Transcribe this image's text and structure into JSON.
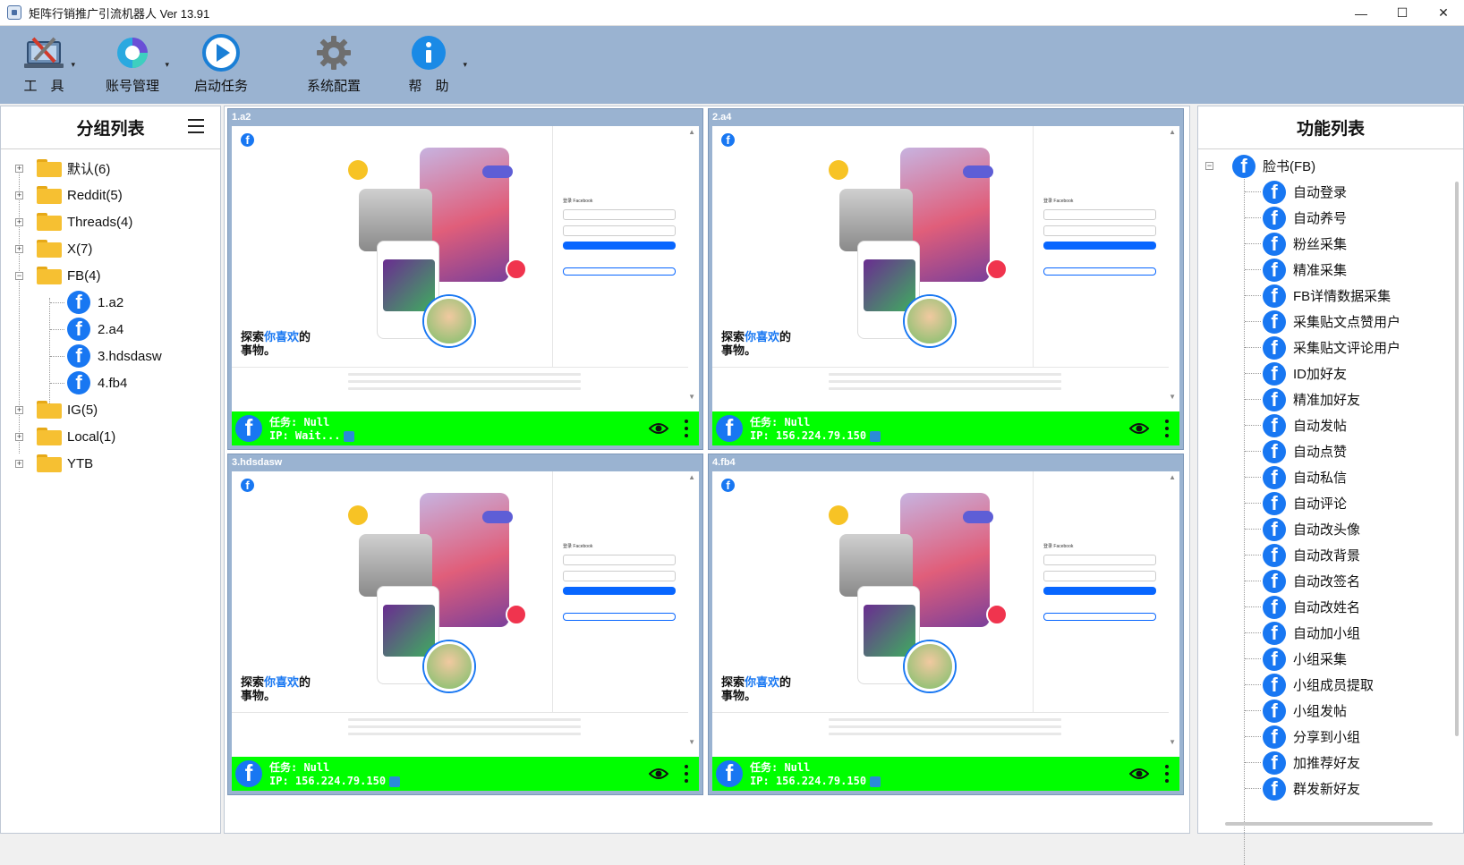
{
  "window": {
    "title": "矩阵行销推广引流机器人 Ver 13.91",
    "minimize": "—",
    "maximize": "☐",
    "close": "✕"
  },
  "toolbar": {
    "tools": "工　具",
    "accounts": "账号管理",
    "start_task": "启动任务",
    "settings": "系统配置",
    "help": "帮　助",
    "dropdown_glyph": "▾"
  },
  "left": {
    "title": "分组列表",
    "groups": [
      {
        "label": "默认(6)",
        "expanded": false
      },
      {
        "label": "Reddit(5)",
        "expanded": false
      },
      {
        "label": "Threads(4)",
        "expanded": false
      },
      {
        "label": "X(7)",
        "expanded": false
      },
      {
        "label": "FB(4)",
        "expanded": true
      },
      {
        "label": "IG(5)",
        "expanded": false
      },
      {
        "label": "Local(1)",
        "expanded": false
      },
      {
        "label": "YTB",
        "expanded": false
      }
    ],
    "fb_children": [
      "1.a2",
      "2.a4",
      "3.hdsdasw",
      "4.fb4"
    ]
  },
  "tiles": [
    {
      "name": "1.a2",
      "task": "任务: Null",
      "ip": "IP: Wait..."
    },
    {
      "name": "2.a4",
      "task": "任务: Null",
      "ip": "IP: 156.224.79.150"
    },
    {
      "name": "3.hdsdasw",
      "task": "任务: Null",
      "ip": "IP: 156.224.79.150"
    },
    {
      "name": "4.fb4",
      "task": "任务: Null",
      "ip": "IP: 156.224.79.150"
    }
  ],
  "fb_page": {
    "explore_a": "探索",
    "explore_hl": "你喜欢",
    "explore_b": "的",
    "explore_c": "事物。",
    "fb_letter": "f",
    "login_caption": "登录 Facebook"
  },
  "right": {
    "title": "功能列表",
    "root": "脸书(FB)",
    "items": [
      "自动登录",
      "自动养号",
      "粉丝采集",
      "精准采集",
      "FB详情数据采集",
      "采集贴文点赞用户",
      "采集贴文评论用户",
      "ID加好友",
      "精准加好友",
      "自动发帖",
      "自动点赞",
      "自动私信",
      "自动评论",
      "自动改头像",
      "自动改背景",
      "自动改签名",
      "自动改姓名",
      "自动加小组",
      "小组采集",
      "小组成员提取",
      "小组发帖",
      "分享到小组",
      "加推荐好友",
      "群发新好友"
    ]
  },
  "colors": {
    "toolbar_bg": "#9ab3d1",
    "status_green": "#00ff00",
    "fb_blue": "#1877f2",
    "folder_yellow": "#f6c032"
  }
}
